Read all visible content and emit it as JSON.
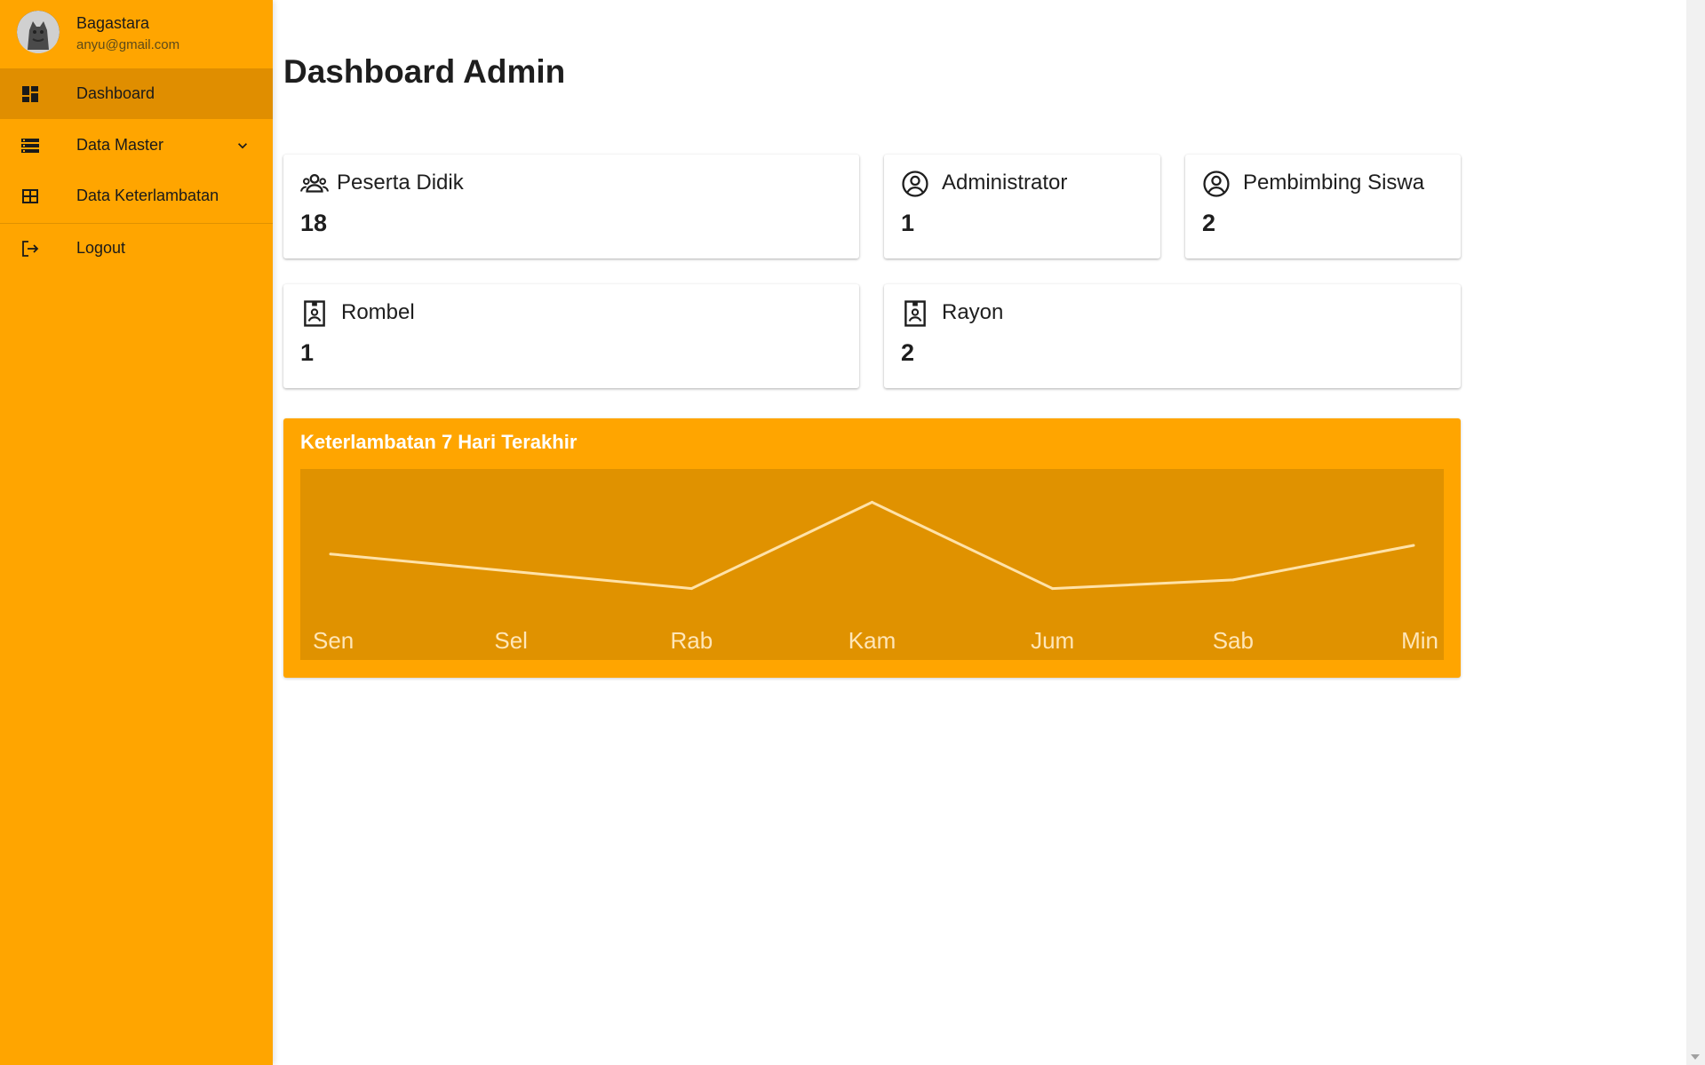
{
  "profile": {
    "name": "Bagastara",
    "email": "anyu@gmail.com"
  },
  "nav": {
    "dashboard": "Dashboard",
    "data_master": "Data Master",
    "data_keterlambatan": "Data Keterlambatan",
    "logout": "Logout"
  },
  "page": {
    "title": "Dashboard Admin"
  },
  "cards": {
    "peserta_didik": {
      "label": "Peserta Didik",
      "value": "18"
    },
    "administrator": {
      "label": "Administrator",
      "value": "1"
    },
    "pembimbing_siswa": {
      "label": "Pembimbing Siswa",
      "value": "2"
    },
    "rombel": {
      "label": "Rombel",
      "value": "1"
    },
    "rayon": {
      "label": "Rayon",
      "value": "2"
    }
  },
  "colors": {
    "accent": "#ffa500",
    "accent_dark": "#e08e00",
    "chart_bg": "#e09200",
    "line": "#ffe2a8"
  },
  "chart_data": {
    "type": "line",
    "title": "Keterlambatan 7 Hari Terakhir",
    "categories": [
      "Sen",
      "Sel",
      "Rab",
      "Kam",
      "Jum",
      "Sab",
      "Min"
    ],
    "values": [
      3,
      2,
      1,
      6,
      1,
      1.5,
      3.5
    ],
    "ylim": [
      0,
      7
    ],
    "grid": false
  }
}
